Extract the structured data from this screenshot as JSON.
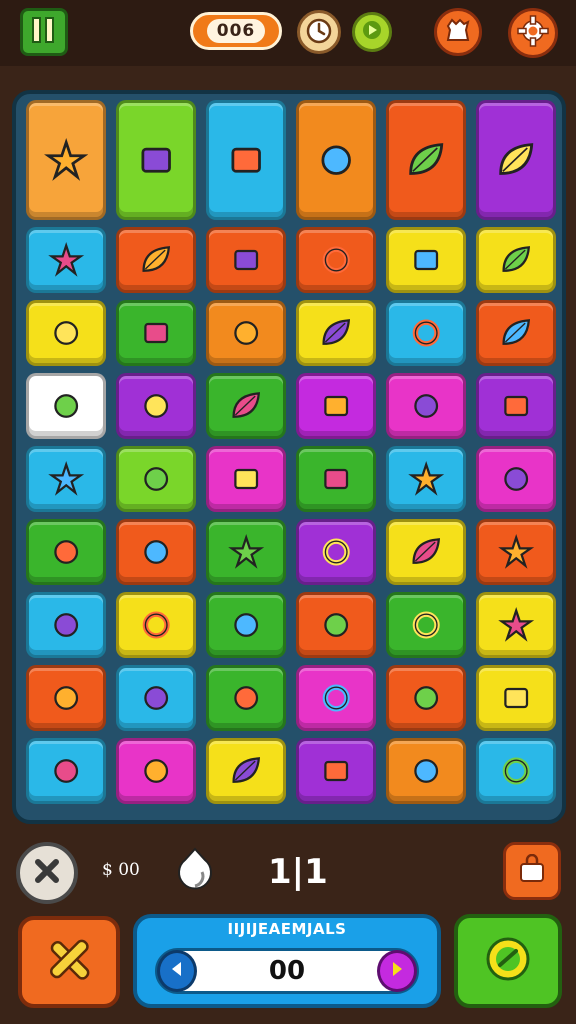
{
  "topbar": {
    "score": "006",
    "buttons": [
      "pause-icon",
      "timer-icon",
      "play-icon",
      "character-icon",
      "gear-icon"
    ]
  },
  "board": {
    "rows": [
      [
        "#f7a43a",
        "#7ad62a",
        "#2ab8e8",
        "#f28a1e",
        "#f05a1c",
        "#a030d6"
      ],
      [
        "#2ab8e8",
        "#f05a1c",
        "#f05a1c",
        "#f05a1c",
        "#f5e01a",
        "#f5e01a"
      ],
      [
        "#f5e01a",
        "#3ab52c",
        "#f28a1e",
        "#f5e01a",
        "#2ab8e8",
        "#f05a1c"
      ],
      [
        "#ffffff",
        "#a030d6",
        "#3ab52c",
        "#c42adf",
        "#e834c8",
        "#a030d6"
      ],
      [
        "#2ab8e8",
        "#7ad62a",
        "#e834c8",
        "#3ab52c",
        "#2ab8e8",
        "#e834c8"
      ],
      [
        "#3ab52c",
        "#f05a1c",
        "#3ab52c",
        "#a030d6",
        "#f5e01a",
        "#f05a1c"
      ],
      [
        "#2ab8e8",
        "#f5e01a",
        "#3ab52c",
        "#f05a1c",
        "#3ab52c",
        "#f5e01a"
      ],
      [
        "#f05a1c",
        "#2ab8e8",
        "#3ab52c",
        "#e834c8",
        "#f05a1c",
        "#f5e01a"
      ],
      [
        "#2ab8e8",
        "#e834c8",
        "#f5e01a",
        "#a030d6",
        "#f28a1e",
        "#2ab8e8"
      ]
    ],
    "icons": [
      [
        "dagger-icon",
        "gear-tower-icon",
        "cake-shoe-icon",
        "crystal-plant-icon",
        "leaf-shell-icon",
        "leaf-icon"
      ],
      [
        "star-icon",
        "leaf-icon",
        "log-icon",
        "ring-icon",
        "bag-icon",
        "leaf-icon"
      ],
      [
        "banana-icon",
        "pot-icon",
        "capsule-icon",
        "palm-icon",
        "globe-icon",
        "leaf-icon"
      ],
      [
        "fish-icon",
        "melon-icon",
        "clover-icon",
        "vase-icon",
        "robot-icon",
        "jar-icon"
      ],
      [
        "kite-icon",
        "banana-icon",
        "cheese-icon",
        "board-icon",
        "wand-icon",
        "shell-icon"
      ],
      [
        "shell-icon",
        "plum-icon",
        "star-icon",
        "ring-icon",
        "broccoli-icon",
        "sun-icon"
      ],
      [
        "nut-icon",
        "donut-icon",
        "apple-icon",
        "horn-icon",
        "ring-icon",
        "kite-icon"
      ],
      [
        "egg-icon",
        "pineapple-icon",
        "tools-icon",
        "spinner-icon",
        "tomato-icon",
        "building-icon"
      ],
      [
        "carrot-icon",
        "brush-icon",
        "herb-icon",
        "lantern-icon",
        "walnut-icon",
        "target-icon"
      ]
    ]
  },
  "footer": {
    "coins": "$ 00",
    "moves": "1|1",
    "panel_title": "IIJIJEAEMJALS",
    "panel_value": "00"
  },
  "colors": {
    "accent_orange": "#f06a20",
    "accent_blue": "#1aa0e8",
    "accent_green": "#4fc424",
    "background": "#3a2418"
  }
}
